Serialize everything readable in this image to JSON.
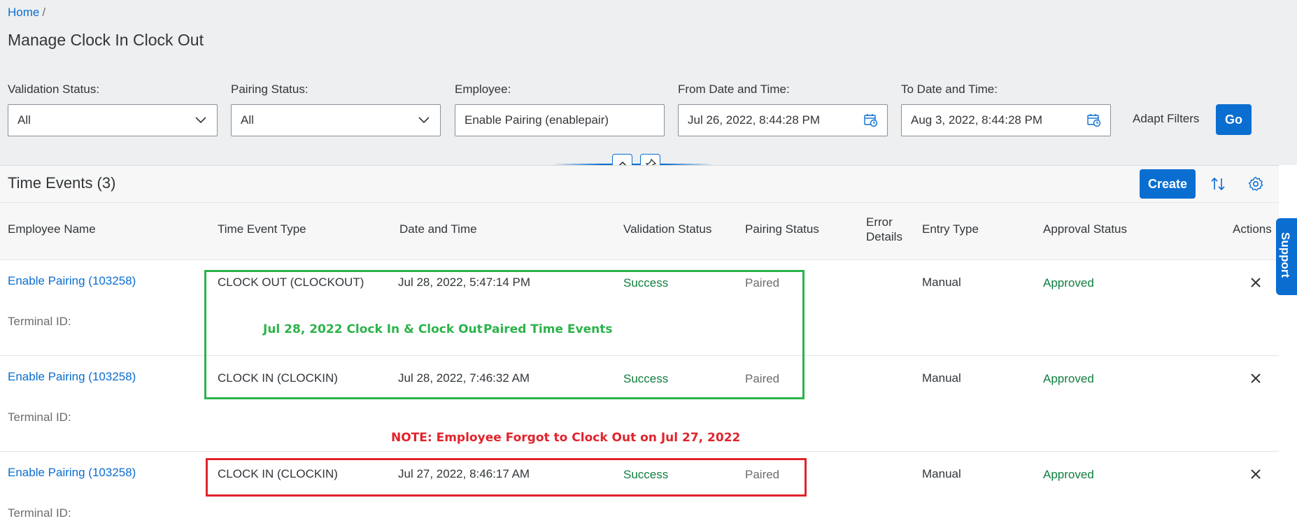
{
  "breadcrumb": {
    "home": "Home",
    "separator": "/"
  },
  "page": {
    "title": "Manage Clock In Clock Out"
  },
  "filters": {
    "validation_status": {
      "label": "Validation Status:",
      "value": "All"
    },
    "pairing_status": {
      "label": "Pairing Status:",
      "value": "All"
    },
    "employee": {
      "label": "Employee:",
      "value": "Enable Pairing (enablepair)"
    },
    "from_date": {
      "label": "From Date and Time:",
      "value": "Jul 26, 2022, 8:44:28 PM"
    },
    "to_date": {
      "label": "To Date and Time:",
      "value": "Aug 3, 2022, 8:44:28 PM"
    },
    "adapt_filters": "Adapt Filters",
    "go": "Go"
  },
  "table": {
    "title": "Time Events (3)",
    "create": "Create",
    "columns": {
      "employee_name": "Employee Name",
      "time_event_type": "Time Event Type",
      "date_time": "Date and Time",
      "validation_status": "Validation Status",
      "pairing_status": "Pairing Status",
      "error_details_1": "Error",
      "error_details_2": "Details",
      "entry_type": "Entry Type",
      "approval_status": "Approval Status",
      "actions": "Actions"
    },
    "rows": [
      {
        "employee": "Enable Pairing (103258)",
        "terminal": "Terminal ID:",
        "type": "CLOCK OUT (CLOCKOUT)",
        "datetime": "Jul 28, 2022, 5:47:14 PM",
        "validation": "Success",
        "pairing": "Paired",
        "entry": "Manual",
        "approval": "Approved"
      },
      {
        "employee": "Enable Pairing (103258)",
        "terminal": "Terminal ID:",
        "type": "CLOCK IN (CLOCKIN)",
        "datetime": "Jul 28, 2022, 7:46:32 AM",
        "validation": "Success",
        "pairing": "Paired",
        "entry": "Manual",
        "approval": "Approved"
      },
      {
        "employee": "Enable Pairing (103258)",
        "terminal": "Terminal ID:",
        "type": "CLOCK IN (CLOCKIN)",
        "datetime": "Jul 27, 2022, 8:46:17 AM",
        "validation": "Success",
        "pairing": "Paired",
        "entry": "Manual",
        "approval": "Approved"
      }
    ]
  },
  "annotations": {
    "green_left": "Jul 28, 2022 Clock In & Clock Out",
    "green_right": "Paired Time Events",
    "red_note": "NOTE: Employee Forgot to Clock Out on Jul 27, 2022"
  },
  "support": "Support",
  "colors": {
    "brand": "#0a6ed1",
    "success": "#107e3e",
    "annotation_green": "#2cb34a",
    "annotation_red": "#e0242c"
  }
}
